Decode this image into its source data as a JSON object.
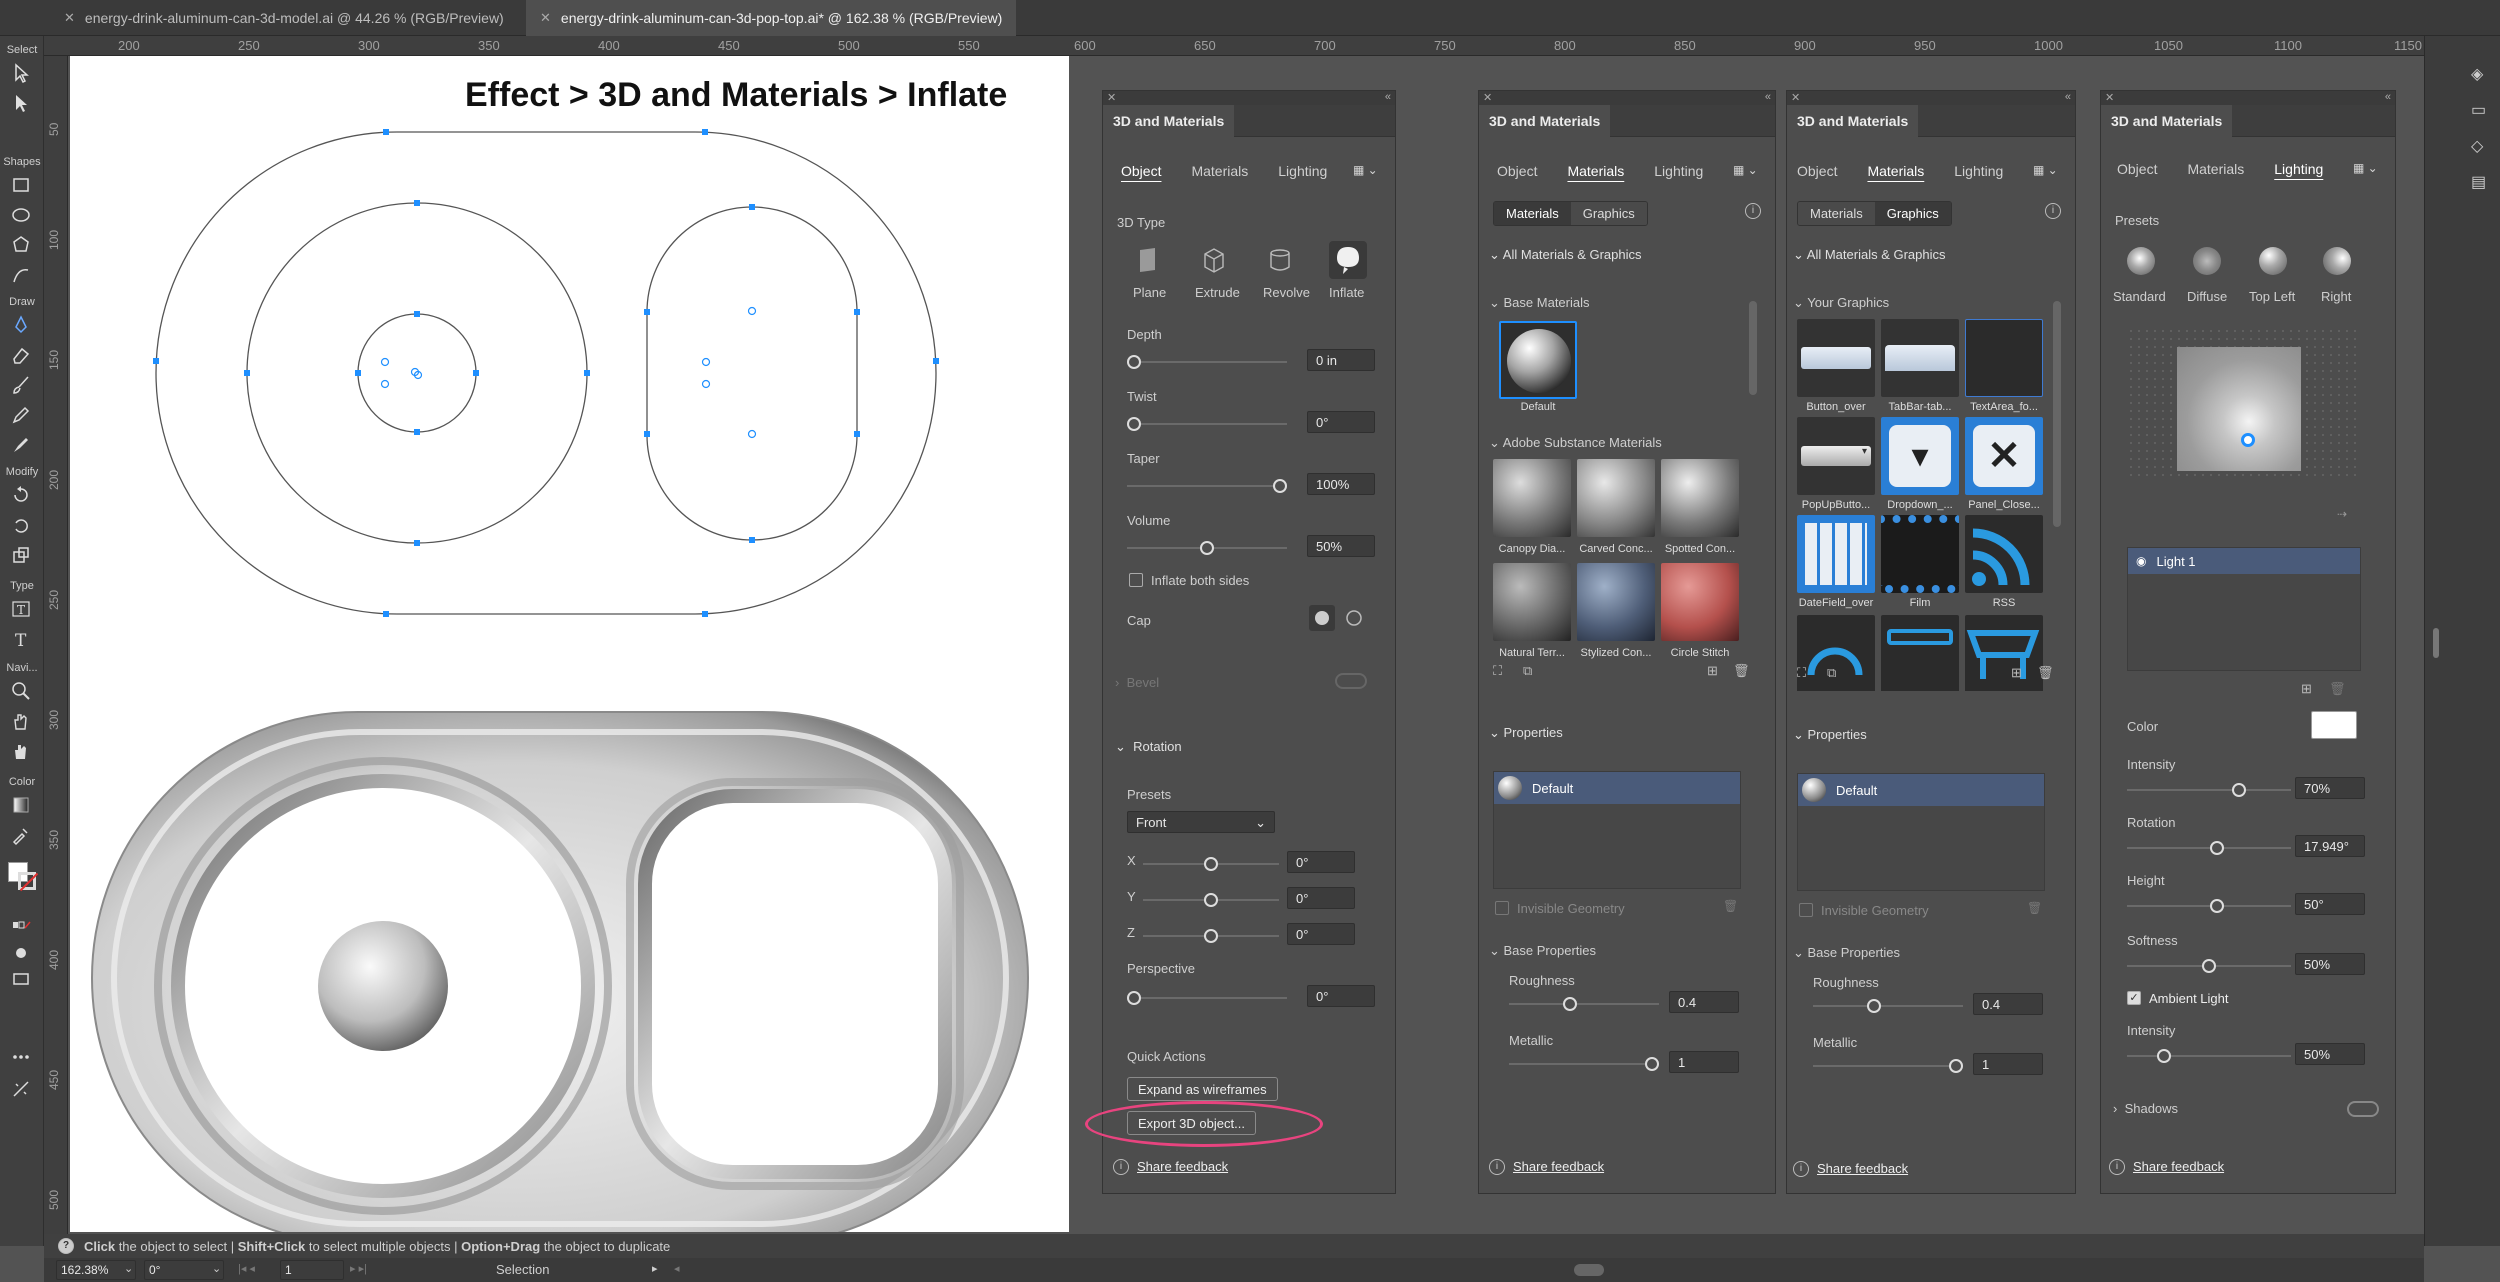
{
  "tabs": [
    {
      "label": "energy-drink-aluminum-can-3d-model.ai @ 44.26 % (RGB/Preview)",
      "active": false
    },
    {
      "label": "energy-drink-aluminum-can-3d-pop-top.ai* @ 162.38 % (RGB/Preview)",
      "active": true
    }
  ],
  "toolbar": {
    "groups": [
      "Select",
      "Shapes",
      "Draw",
      "Modify",
      "Type",
      "Navi...",
      "Color"
    ],
    "icons": [
      "selection-tool-icon",
      "direct-selection-icon",
      "rectangle-icon",
      "ellipse-icon",
      "polygon-icon",
      "shaper-icon",
      "eraser-icon",
      "paintbrush-icon",
      "pencil-icon",
      "pen-icon",
      "rotate-icon",
      "scale-icon",
      "type-icon",
      "zoom-icon",
      "hand-icon",
      "rotate-view-icon",
      "gradient-icon",
      "eyedropper-icon",
      "more-tools-icon"
    ]
  },
  "ruler": {
    "top": [
      "200",
      "250",
      "300",
      "350",
      "400",
      "450",
      "500",
      "550",
      "600",
      "650",
      "700",
      "750",
      "800",
      "850",
      "900",
      "950",
      "1000",
      "1050",
      "1100",
      "1150"
    ],
    "left": [
      "50",
      "100",
      "150",
      "200",
      "250",
      "300",
      "350",
      "400",
      "450",
      "500"
    ]
  },
  "canvas": {
    "annotation": "Effect > 3D and Materials > Inflate"
  },
  "panel1": {
    "title": "3D and Materials",
    "tabs": [
      "Object",
      "Materials",
      "Lighting"
    ],
    "active_tab": "Object",
    "type_label": "3D Type",
    "types": [
      "Plane",
      "Extrude",
      "Revolve",
      "Inflate"
    ],
    "active_type": "Inflate",
    "depth": {
      "label": "Depth",
      "value": "0 in",
      "pos": 0
    },
    "twist": {
      "label": "Twist",
      "value": "0°",
      "pos": 0
    },
    "taper": {
      "label": "Taper",
      "value": "100%",
      "pos": 1
    },
    "volume": {
      "label": "Volume",
      "value": "50%",
      "pos": 0.5
    },
    "inflate_both": "Inflate both sides",
    "cap": "Cap",
    "bevel": "Bevel",
    "rotation": "Rotation",
    "presets_label": "Presets",
    "preset_value": "Front",
    "x": {
      "label": "X",
      "value": "0°"
    },
    "y": {
      "label": "Y",
      "value": "0°"
    },
    "z": {
      "label": "Z",
      "value": "0°"
    },
    "perspective": {
      "label": "Perspective",
      "value": "0°"
    },
    "quick_actions": "Quick Actions",
    "expand_btn": "Expand as wireframes",
    "export_btn": "Export 3D object...",
    "feedback": "Share feedback"
  },
  "panel2": {
    "title": "3D and Materials",
    "tabs": [
      "Object",
      "Materials",
      "Lighting"
    ],
    "active_tab": "Materials",
    "seg": [
      "Materials",
      "Graphics"
    ],
    "seg_active": "Materials",
    "all_header": "All Materials & Graphics",
    "base_header": "Base Materials",
    "default_label": "Default",
    "substance_header": "Adobe Substance Materials",
    "materials": [
      "Canopy Dia...",
      "Carved Conc...",
      "Spotted Con...",
      "Natural Terr...",
      "Stylized Con...",
      "Circle Stitch"
    ],
    "properties": "Properties",
    "prop_item": "Default",
    "invisible": "Invisible Geometry",
    "base_props": "Base Properties",
    "roughness": {
      "label": "Roughness",
      "value": "0.4",
      "pos": 0.4
    },
    "metallic": {
      "label": "Metallic",
      "value": "1",
      "pos": 1
    },
    "feedback": "Share feedback"
  },
  "panel3": {
    "title": "3D and Materials",
    "tabs": [
      "Object",
      "Materials",
      "Lighting"
    ],
    "active_tab": "Materials",
    "seg": [
      "Materials",
      "Graphics"
    ],
    "seg_active": "Graphics",
    "all_header": "All Materials & Graphics",
    "your_header": "Your Graphics",
    "graphics": [
      "Button_over",
      "TabBar-tab...",
      "TextArea_fo...",
      "PopUpButto...",
      "Dropdown_...",
      "Panel_Close...",
      "DateField_over",
      "Film",
      "RSS"
    ],
    "properties": "Properties",
    "prop_item": "Default",
    "invisible": "Invisible Geometry",
    "base_props": "Base Properties",
    "roughness": {
      "label": "Roughness",
      "value": "0.4",
      "pos": 0.4
    },
    "metallic": {
      "label": "Metallic",
      "value": "1",
      "pos": 1
    },
    "feedback": "Share feedback"
  },
  "panel4": {
    "title": "3D and Materials",
    "tabs": [
      "Object",
      "Materials",
      "Lighting"
    ],
    "active_tab": "Lighting",
    "presets_label": "Presets",
    "presets": [
      "Standard",
      "Diffuse",
      "Top Left",
      "Right"
    ],
    "light_item": "Light 1",
    "color_label": "Color",
    "light_color": "#ffffff",
    "intensity": {
      "label": "Intensity",
      "value": "70%",
      "pos": 0.7
    },
    "rotation": {
      "label": "Rotation",
      "value": "17.949°",
      "pos": 0.55
    },
    "height": {
      "label": "Height",
      "value": "50°",
      "pos": 0.55
    },
    "softness": {
      "label": "Softness",
      "value": "50%",
      "pos": 0.5
    },
    "ambient": "Ambient Light",
    "ambient_intensity": {
      "label": "Intensity",
      "value": "50%",
      "pos": 0.2
    },
    "shadows": "Shadows",
    "feedback": "Share feedback"
  },
  "status": {
    "help": "?",
    "t1": "Click",
    "t2": " the object to select  |  ",
    "t3": "Shift+Click",
    "t4": " to select multiple objects  |  ",
    "t5": "Option+Drag",
    "t6": " the object to duplicate"
  },
  "bottom": {
    "zoom": "162.38%",
    "angle": "0°",
    "artboard": "1",
    "mode": "Selection"
  },
  "colors": {
    "accent": "#1e8fff",
    "highlight_ellipse": "#e8447f",
    "selected_row": "#4a5b7a"
  }
}
